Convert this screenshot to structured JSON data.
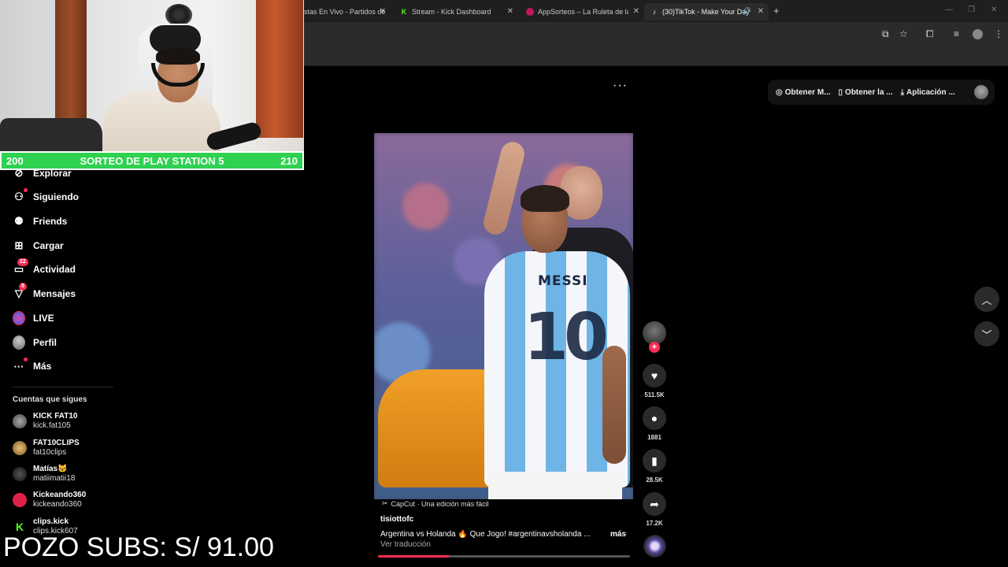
{
  "browser": {
    "tabs": [
      {
        "label": "stas En Vivo - Partidos de",
        "favicon": "globe-icon",
        "active": false
      },
      {
        "label": "Stream - Kick Dashboard",
        "favicon": "kick-icon",
        "active": false
      },
      {
        "label": "AppSorteos – La Ruleta de la S",
        "favicon": "appsorteos-icon",
        "active": false
      },
      {
        "label": "(30)TikTok - Make Your Day",
        "favicon": "tiktok-icon",
        "active": true
      }
    ]
  },
  "tiktok": {
    "topbar": {
      "get_coins": "Obtener M...",
      "get_app": "Obtener la ...",
      "desktop_app": "Aplicación ..."
    },
    "nav": {
      "explore": "Explorar",
      "following": "Siguiendo",
      "friends": "Friends",
      "upload": "Cargar",
      "activity": "Actividad",
      "activity_badge": "22",
      "messages": "Mensajes",
      "messages_badge": "8",
      "live": "LIVE",
      "profile": "Perfil",
      "more": "Más"
    },
    "following_title": "Cuentas que sigues",
    "accounts": [
      {
        "name": "KICK FAT10",
        "handle": "kick.fat105"
      },
      {
        "name": "FAT10CLIPS",
        "handle": "fat10clips"
      },
      {
        "name": "Matías🐱",
        "handle": "matiimatii18"
      },
      {
        "name": "Kickeando360",
        "handle": "kickeando360"
      },
      {
        "name": "clips.kick",
        "handle": "clips.kick607"
      }
    ],
    "video": {
      "jersey_name": "MESSI",
      "jersey_number": "10",
      "capcut_label": "CapCut · Una edición más fácil",
      "author": "tisiottofc",
      "description": "Argentina vs Holanda 🔥 Que Jogo! #argentinavsholanda ...",
      "more_label": "más",
      "translate_label": "Ver traducción",
      "progress": 0.28
    },
    "actions": {
      "likes": "511.5K",
      "comments": "1881",
      "saves": "28.5K",
      "shares": "17.2K"
    }
  },
  "stream_overlay": {
    "raffle_left": "200",
    "raffle_title": "SORTEO DE PLAY STATION 5",
    "raffle_right": "210",
    "pozo": "POZO SUBS: S/ 91.00"
  },
  "colors": {
    "tiktok_red": "#fe2c55",
    "raffle_green": "#2fd150",
    "kick_green": "#53fc18"
  }
}
